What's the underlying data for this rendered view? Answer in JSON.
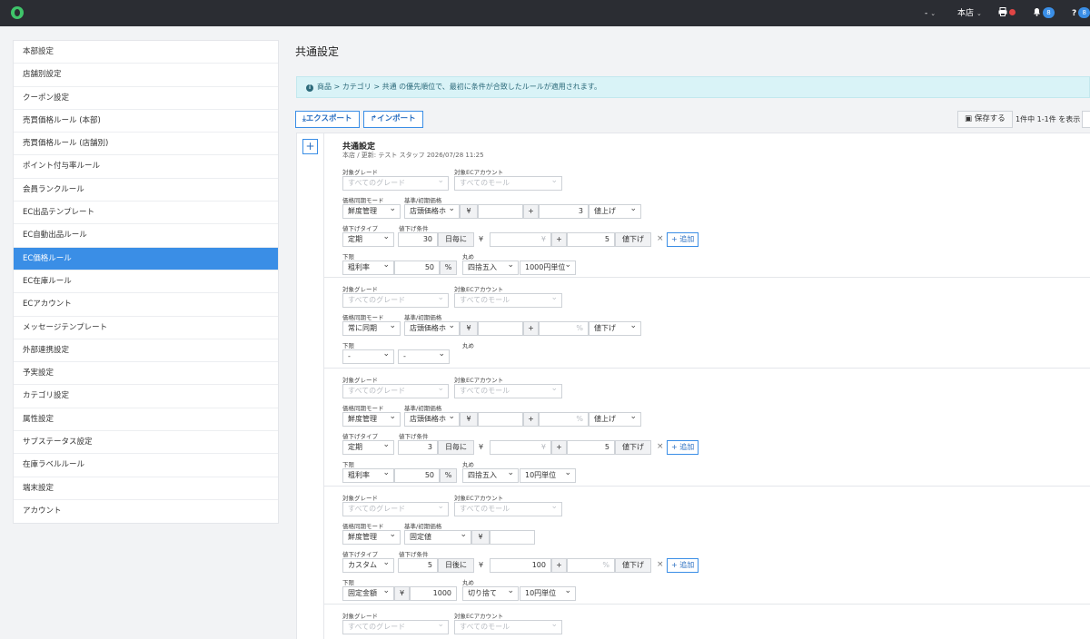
{
  "topbar": {
    "menu1": "-",
    "store": "本店",
    "bell_count": "8",
    "help_count": "8",
    "help_icon": "?"
  },
  "sidebar": {
    "items": [
      "本部設定",
      "店舗別設定",
      "クーポン設定",
      "売買価格ルール (本部)",
      "売買価格ルール (店舗別)",
      "ポイント付与率ルール",
      "会員ランクルール",
      "EC出品テンプレート",
      "EC自動出品ルール",
      "EC価格ルール",
      "EC在庫ルール",
      "ECアカウント",
      "メッセージテンプレート",
      "外部連携設定",
      "予実設定",
      "カテゴリ設定",
      "属性設定",
      "サブステータス設定",
      "在庫ラベルルール",
      "端末設定",
      "アカウント"
    ],
    "active_index": 9
  },
  "main": {
    "title": "共通設定",
    "info": "商品 > カテゴリ > 共通 の優先順位で、最初に条件が合致したルールが適用されます。",
    "export_label": "エクスポート",
    "import_label": "インポート",
    "save_label": "保存する",
    "pager": "1件中 1-1件 を表示",
    "add_plus": "+",
    "rule_title": "共通設定",
    "rule_meta": "本店 / 更新: テスト スタッフ 2026/07/28 11:25"
  },
  "labels": {
    "grade": "対象グレード",
    "ec_account": "対象ECアカウント",
    "sync_mode": "価格同期モード",
    "base_price": "基準/初期価格",
    "down_type": "値下げタイプ",
    "down_cond": "値下げ条件",
    "lower_limit": "下限",
    "rounding": "丸め"
  },
  "common": {
    "grade_ph": "すべてのグレード",
    "ec_ph": "すべてのモール",
    "yen": "¥",
    "plus": "+",
    "pct": "%",
    "x": "×",
    "add": "+ 追加"
  },
  "rules": [
    {
      "sync": "鮮度管理",
      "base": "店頭価格ホ",
      "base_yen_val": "",
      "adj_val": "3",
      "adj_unit": "",
      "direction": "値上げ",
      "type": "定期",
      "days": "30",
      "days_unit": "日毎に",
      "cond_yen_val": "",
      "cond_adj": "5",
      "cond_dir": "値下げ",
      "lower": "粗利率",
      "lower_val": "50",
      "lower_unit": "%",
      "round": "四捨五入",
      "round_unit": "1000円単位"
    },
    {
      "sync": "常に同期",
      "base": "店頭価格ホ",
      "base_yen_val": "",
      "adj_val": "",
      "adj_unit": "%",
      "direction": "値下げ",
      "lower": "-",
      "round": "-"
    },
    {
      "sync": "鮮度管理",
      "base": "店頭価格ホ",
      "base_yen_val": "",
      "adj_val": "",
      "adj_unit": "%",
      "direction": "値上げ",
      "type": "定期",
      "days": "3",
      "days_unit": "日毎に",
      "cond_yen_val": "",
      "cond_adj": "5",
      "cond_dir": "値下げ",
      "lower": "粗利率",
      "lower_val": "50",
      "lower_unit": "%",
      "round": "四捨五入",
      "round_unit": "10円単位"
    },
    {
      "sync": "鮮度管理",
      "base": "固定値",
      "base_yen_val": "",
      "type": "カスタム",
      "days": "5",
      "days_unit": "日後に",
      "cond_yen_val": "100",
      "cond_adj": "",
      "cond_adj_unit": "%",
      "cond_dir": "値下げ",
      "lower": "固定金額",
      "lower_val": "1000",
      "round": "切り捨て",
      "round_unit": "10円単位"
    }
  ]
}
